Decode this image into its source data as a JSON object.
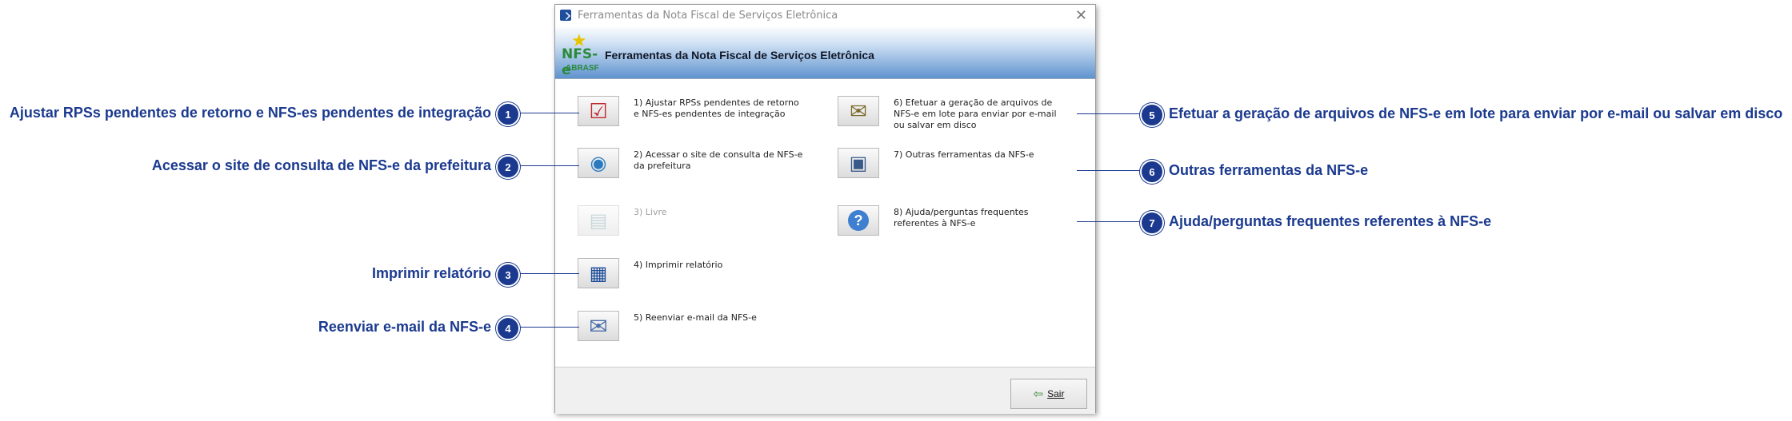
{
  "window": {
    "title": "Ferramentas da Nota Fiscal de Serviços Eletrônica",
    "close_glyph": "✕",
    "header_title": "Ferramentas da Nota Fiscal de Serviços Eletrônica",
    "logo": {
      "text": "NFS-e",
      "subtext": "ABRASF"
    }
  },
  "tools": [
    {
      "label": "1) Ajustar RPSs pendentes de retorno e NFS-es pendentes de integração",
      "icon": "checklist-icon",
      "glyph": "☑"
    },
    {
      "label": "2) Acessar o site de consulta de NFS-e da prefeitura",
      "icon": "globe-icon",
      "glyph": "🌐"
    },
    {
      "label": "3) Livre",
      "icon": "blank-document-icon",
      "glyph": "📄",
      "enabled": false
    },
    {
      "label": "4) Imprimir relatório",
      "icon": "report-icon",
      "glyph": "📝"
    },
    {
      "label": "5) Reenviar e-mail da NFS-e",
      "icon": "envelope-icon",
      "glyph": "✉"
    },
    {
      "label": "6) Efetuar a geração de arquivos de NFS-e em lote para enviar por e-mail ou salvar em disco",
      "icon": "email-batch-icon",
      "glyph": "📨"
    },
    {
      "label": "7) Outras ferramentas da NFS-e",
      "icon": "tools-computer-icon",
      "glyph": "🖥"
    },
    {
      "label": "8) Ajuda/perguntas frequentes referentes à NFS-e",
      "icon": "help-icon",
      "glyph": "?"
    }
  ],
  "footer": {
    "exit_label": "Sair",
    "exit_icon": "exit-door-icon"
  },
  "callouts": [
    {
      "number": "1",
      "text": "Ajustar RPSs pendentes de retorno e NFS-es pendentes de integração"
    },
    {
      "number": "2",
      "text": "Acessar o site de consulta de NFS-e da prefeitura"
    },
    {
      "number": "3",
      "text": "Imprimir relatório"
    },
    {
      "number": "4",
      "text": "Reenviar e-mail da NFS-e"
    },
    {
      "number": "5",
      "text": "Efetuar a geração de arquivos de NFS-e em lote para enviar por e-mail ou salvar em disco"
    },
    {
      "number": "6",
      "text": "Outras ferramentas da NFS-e"
    },
    {
      "number": "7",
      "text": "Ajuda/perguntas frequentes referentes à NFS-e"
    }
  ],
  "colors": {
    "callout": "#1b3a8f",
    "header_gradient_end": "#5f93cf",
    "logo_green": "#2a8a3a"
  }
}
